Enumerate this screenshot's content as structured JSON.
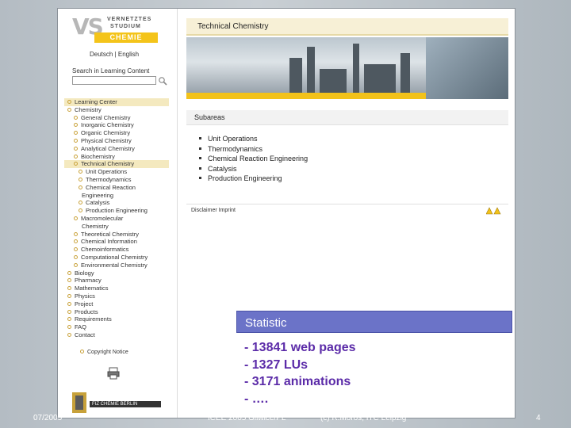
{
  "sidebar": {
    "logo": {
      "mark": "VS",
      "line1": "VERNETZTES",
      "line2": "STUDIUM",
      "badge": "CHEMIE"
    },
    "language_links": "Deutsch | English",
    "search_label": "Search in Learning Content",
    "search_value": "",
    "nav": [
      {
        "label": "Learning Center",
        "level": "l1",
        "bullet": true,
        "selected": true
      },
      {
        "label": "Chemistry",
        "level": "l1",
        "bullet": true,
        "selected": false
      },
      {
        "label": "General Chemistry",
        "level": "l2",
        "bullet": true,
        "selected": false
      },
      {
        "label": "Inorganic Chemistry",
        "level": "l2",
        "bullet": true,
        "selected": false
      },
      {
        "label": "Organic Chemistry",
        "level": "l2",
        "bullet": true,
        "selected": false
      },
      {
        "label": "Physical Chemistry",
        "level": "l2",
        "bullet": true,
        "selected": false
      },
      {
        "label": "Analytical Chemistry",
        "level": "l2",
        "bullet": true,
        "selected": false
      },
      {
        "label": "Biochemistry",
        "level": "l2",
        "bullet": true,
        "selected": false
      },
      {
        "label": "Technical Chemistry",
        "level": "l2",
        "bullet": true,
        "selected": true
      },
      {
        "label": "Unit Operations",
        "level": "l3",
        "bullet": true,
        "selected": false
      },
      {
        "label": "Thermodynamics",
        "level": "l3",
        "bullet": true,
        "selected": false
      },
      {
        "label": "Chemical Reaction",
        "level": "l3",
        "bullet": true,
        "selected": false
      },
      {
        "label": "Engineering",
        "level": "cont",
        "bullet": false,
        "selected": false
      },
      {
        "label": "Catalysis",
        "level": "l3",
        "bullet": true,
        "selected": false
      },
      {
        "label": "Production Engineering",
        "level": "l3",
        "bullet": true,
        "selected": false
      },
      {
        "label": "Macromolecular",
        "level": "l2",
        "bullet": true,
        "selected": false
      },
      {
        "label": "Chemistry",
        "level": "cont",
        "bullet": false,
        "selected": false
      },
      {
        "label": "Theoretical Chemistry",
        "level": "l2",
        "bullet": true,
        "selected": false
      },
      {
        "label": "Chemical Information",
        "level": "l2",
        "bullet": true,
        "selected": false
      },
      {
        "label": "Chemoinformatics",
        "level": "l2",
        "bullet": true,
        "selected": false
      },
      {
        "label": "Computational Chemistry",
        "level": "l2",
        "bullet": true,
        "selected": false
      },
      {
        "label": "Environmental Chemistry",
        "level": "l2",
        "bullet": true,
        "selected": false
      },
      {
        "label": "Biology",
        "level": "l1",
        "bullet": true,
        "selected": false
      },
      {
        "label": "Pharmacy",
        "level": "l1",
        "bullet": true,
        "selected": false
      },
      {
        "label": "Mathematics",
        "level": "l1",
        "bullet": true,
        "selected": false
      },
      {
        "label": "Physics",
        "level": "l1",
        "bullet": true,
        "selected": false
      },
      {
        "label": "Project",
        "level": "l1",
        "bullet": true,
        "selected": false
      },
      {
        "label": "Products",
        "level": "l1",
        "bullet": true,
        "selected": false
      },
      {
        "label": "Requirements",
        "level": "l1",
        "bullet": true,
        "selected": false
      },
      {
        "label": "FAQ",
        "level": "l1",
        "bullet": true,
        "selected": false
      },
      {
        "label": "Contact",
        "level": "l1",
        "bullet": true,
        "selected": false
      }
    ],
    "copyright": "Copyright Notice",
    "partner_name": "FIZ CHEMIE BERLIN"
  },
  "main": {
    "title": "Technical Chemistry",
    "subareas_heading": "Subareas",
    "subareas": [
      "Unit Operations",
      "Thermodynamics",
      "Chemical Reaction Engineering",
      "Catalysis",
      "Production Engineering"
    ],
    "footer_links": "Disclaimer   Imprint"
  },
  "statistic": {
    "heading": "Statistic",
    "items": [
      "- 13841 web pages",
      "- 1327 LUs",
      "- 3171 animations",
      "- …."
    ]
  },
  "slide_footer": {
    "date": "07/2005",
    "conference": "ICEE 2005 Gliwice/PL",
    "credit": "(c) R.Moros, ITC Leipzig",
    "page": "4"
  },
  "colors": {
    "accent_yellow": "#f2c21a",
    "statistic_header": "#6b73c8",
    "statistic_text": "#5b2ba8"
  },
  "icons": [
    "search-icon",
    "printer-icon",
    "warning-icon"
  ]
}
